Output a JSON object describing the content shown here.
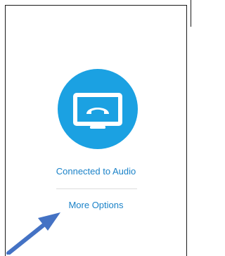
{
  "status": {
    "label": "Connected to Audio"
  },
  "more_options": {
    "label": "More Options"
  },
  "icons": {
    "audio": "monitor-with-phone-handset-icon",
    "pointer": "arrow-pointer-icon"
  },
  "colors": {
    "accent": "#1ba1e2",
    "link_text": "#1a82c8",
    "arrow": "#4472c4"
  }
}
